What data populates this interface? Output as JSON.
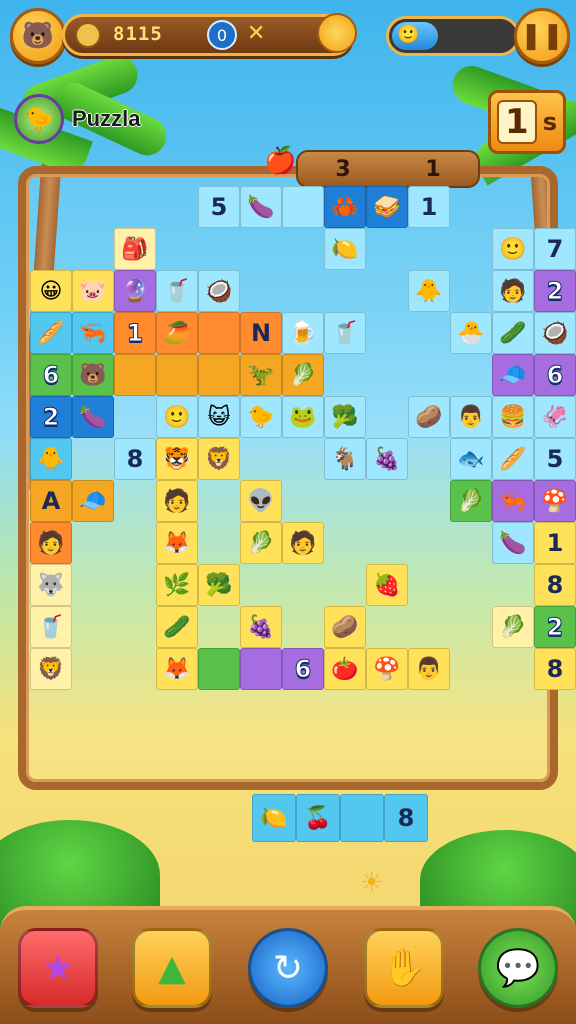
{
  "hud": {
    "coins": "8115",
    "energy_level": 0.38,
    "level_icon_text": "1",
    "level_label": "s"
  },
  "player": {
    "name": "Puzzla"
  },
  "plank": {
    "left": "3",
    "right": "1"
  },
  "board": {
    "numbers": [
      "5",
      "1",
      "7",
      "2",
      "1",
      "6",
      "6",
      "2",
      "8",
      "5",
      "1",
      "8",
      "2",
      "6",
      "8"
    ],
    "letters": [
      "N",
      "A"
    ]
  },
  "bottom_bar": {
    "buttons": [
      "star-power",
      "tree-hint",
      "shuffle",
      "undo-hand",
      "chat"
    ]
  },
  "colors": {
    "accent": "#f29a12",
    "frame": "#a8672d",
    "sky": "#3fb4ec"
  }
}
